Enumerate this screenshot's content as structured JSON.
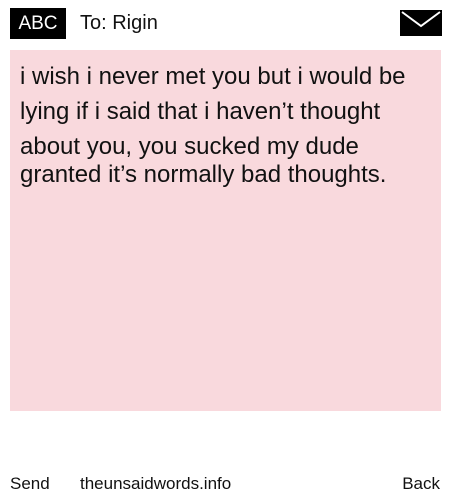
{
  "header": {
    "badge_label": "ABC",
    "recipient": "To: Rigin",
    "mail_icon": "envelope-icon"
  },
  "message": {
    "main_text": "i wish i never met you but i would be lying if i said that i haven’t thought about you, you sucked my dude",
    "overlay_text": "granted it’s normally bad thoughts.",
    "background_color": "#f9d9dd"
  },
  "footer": {
    "send_label": "Send",
    "site_label": "theunsaidwords.info",
    "back_label": "Back"
  }
}
